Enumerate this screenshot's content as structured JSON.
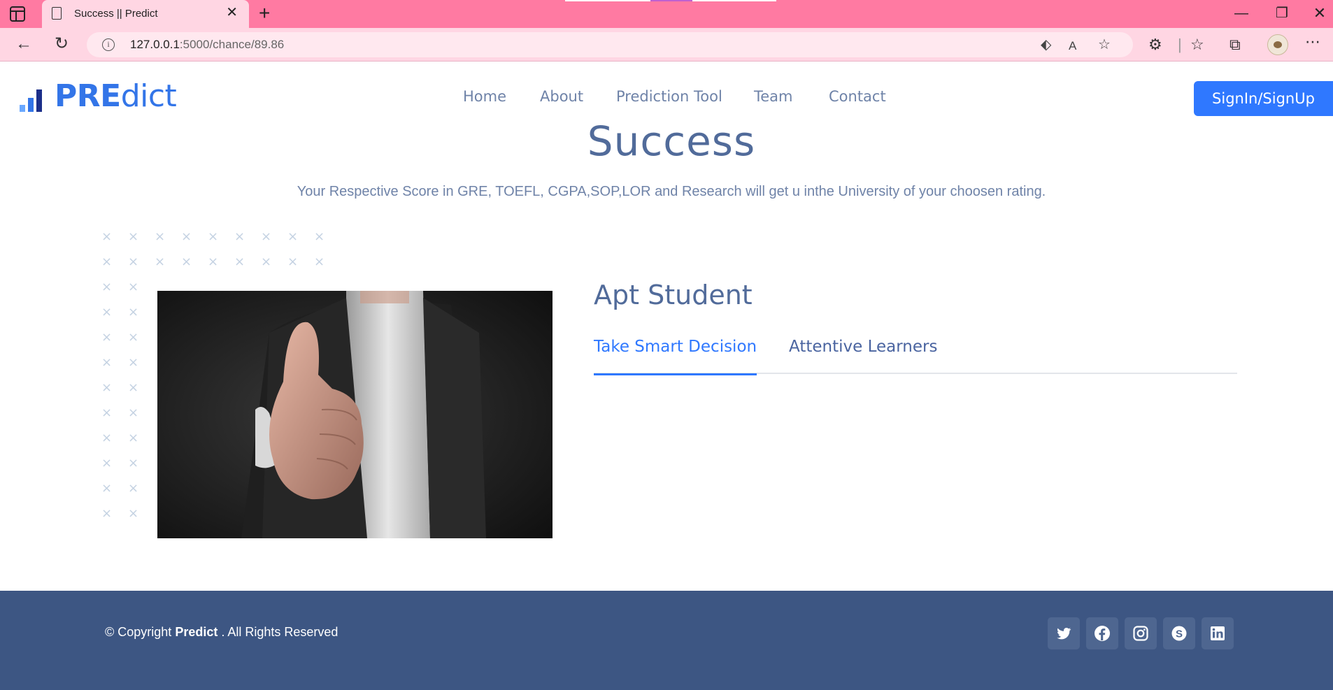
{
  "browser": {
    "tab_title": "Success || Predict",
    "url_host": "127.0.0.1",
    "url_path": ":5000/chance/89.86"
  },
  "site": {
    "logo_strong": "PRE",
    "logo_light": "dict",
    "brand_color": "#3375e8",
    "nav": [
      "Home",
      "About",
      "Prediction Tool",
      "Team",
      "Contact"
    ],
    "signin_label": "SignIn/SignUp"
  },
  "success": {
    "title": "Success",
    "subtitle": "Your Respective Score in GRE, TOEFL, CGPA,SOP,LOR and Research will get u inthe University of your choosen rating."
  },
  "content": {
    "heading": "Apt Student",
    "tabs": [
      "Take Smart Decision",
      "Attentive Learners"
    ],
    "active_tab": 0
  },
  "footer": {
    "copyright_prefix": "© Copyright",
    "brand": "Predict",
    "copyright_suffix": ". All Rights Reserved",
    "social": [
      "twitter-icon",
      "facebook-icon",
      "instagram-icon",
      "skype-icon",
      "linkedin-icon"
    ]
  }
}
